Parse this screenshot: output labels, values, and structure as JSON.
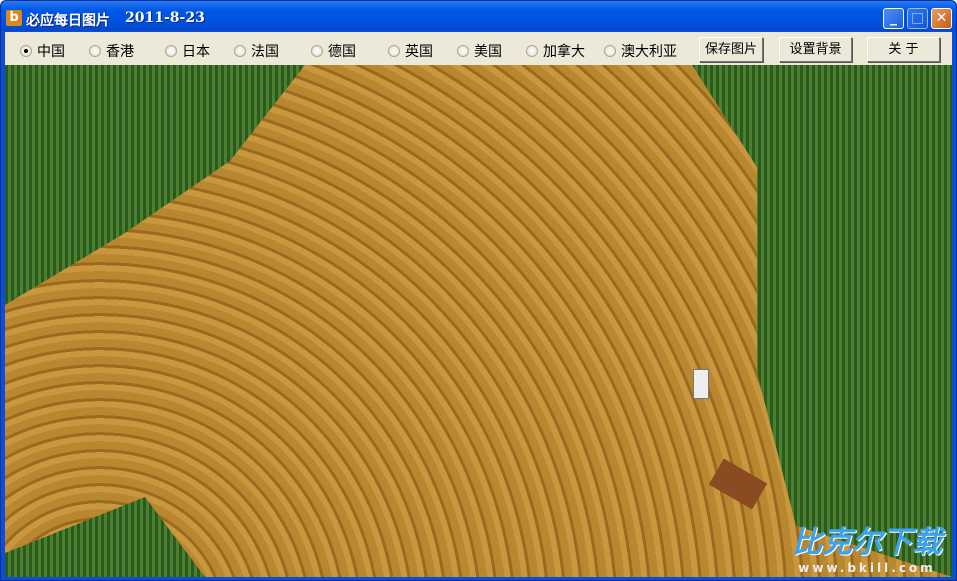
{
  "window": {
    "title": "必应每日图片",
    "date": "2011-8-23",
    "app_icon": "b"
  },
  "controls": {
    "minimize": "_",
    "maximize": "□",
    "close": "✕"
  },
  "regions": [
    {
      "label": "中国",
      "selected": true
    },
    {
      "label": "香港",
      "selected": false
    },
    {
      "label": "日本",
      "selected": false
    },
    {
      "label": "法国",
      "selected": false
    },
    {
      "label": "德国",
      "selected": false
    },
    {
      "label": "英国",
      "selected": false
    },
    {
      "label": "美国",
      "selected": false
    },
    {
      "label": "加拿大",
      "selected": false
    },
    {
      "label": "澳大利亚",
      "selected": false
    }
  ],
  "buttons": {
    "save": "保存图片",
    "set_bg": "设置背景",
    "about": "关 于"
  },
  "watermark": {
    "logo": "比克尔下载",
    "url": "www.bkill.com"
  }
}
